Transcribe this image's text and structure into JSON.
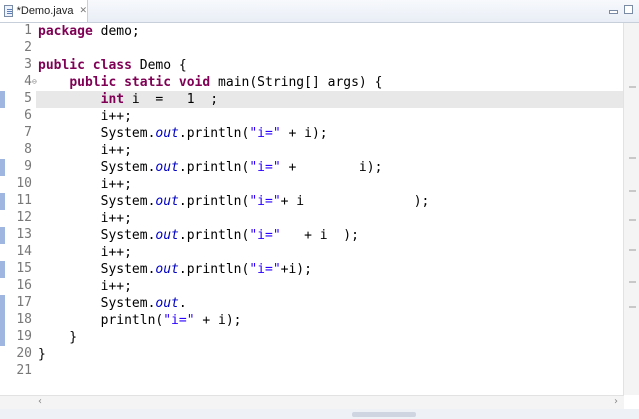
{
  "tab": {
    "title": "*Demo.java",
    "close": "✕",
    "icon": "java-file-icon"
  },
  "line_numbers": [
    "1",
    "2",
    "3",
    "4",
    "5",
    "6",
    "7",
    "8",
    "9",
    "10",
    "11",
    "12",
    "13",
    "14",
    "15",
    "16",
    "17",
    "18",
    "19",
    "20",
    "21"
  ],
  "fold_marker": "⊖",
  "code": {
    "l1_kw": "package",
    "l1_rest": " demo;",
    "l3_kw1": "public",
    "l3_kw2": "class",
    "l3_rest": " Demo {",
    "l4_indent": "    ",
    "l4_kw1": "public",
    "l4_kw2": "static",
    "l4_kw3": "void",
    "l4_rest": " main(String[] args) {",
    "l5_indent": "        ",
    "l5_kw": "int",
    "l5_rest": " i  =   1  ;",
    "l6": "        i++;",
    "l7_pre": "        System.",
    "l7_fld": "out",
    "l7_mid": ".println(",
    "l7_str": "\"i=\"",
    "l7_post": " + i);",
    "l8": "        i++;",
    "l9_pre": "        System.",
    "l9_fld": "out",
    "l9_mid": ".println(",
    "l9_str": "\"i=\"",
    "l9_post": " +        i);",
    "l10": "        i++;",
    "l11_pre": "        System.",
    "l11_fld": "out",
    "l11_mid": ".println(",
    "l11_str": "\"i=\"",
    "l11_post": "+ i              );",
    "l12": "        i++;",
    "l13_pre": "        System.",
    "l13_fld": "out",
    "l13_mid": ".println(",
    "l13_str": "\"i=\"",
    "l13_post": "   + i  );",
    "l14": "        i++;",
    "l15_pre": "        System.",
    "l15_fld": "out",
    "l15_mid": ".println(",
    "l15_str": "\"i=\"",
    "l15_post": "+i);",
    "l16": "        i++;",
    "l17_pre": "        System.",
    "l17_fld": "out",
    "l17_post": ".",
    "l18_pre": "        println(",
    "l18_str": "\"i=\"",
    "l18_post": " + i);",
    "l19": "    }",
    "l20": "}",
    "l21": ""
  },
  "scroll": {
    "left_arrow": "‹",
    "right_arrow": "›"
  },
  "colors": {
    "keyword": "#7f0055",
    "string": "#2a00ff",
    "field": "#0000c0",
    "current_line": "#e8e8e8"
  }
}
